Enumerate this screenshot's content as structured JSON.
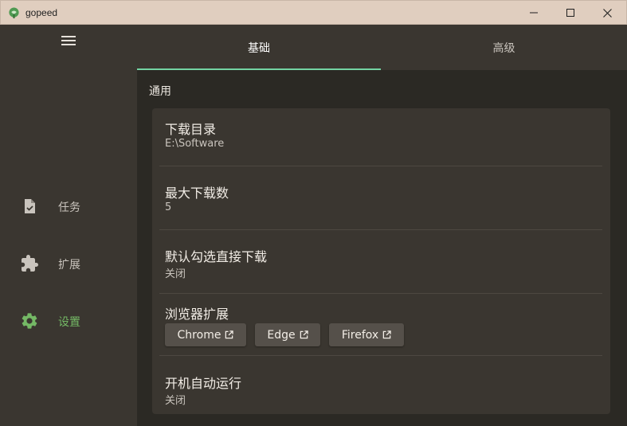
{
  "window": {
    "title": "gopeed",
    "logo_icon": "gopeed-logo-icon",
    "controls": [
      "minimize-icon",
      "maximize-icon",
      "close-icon"
    ]
  },
  "sidebar": {
    "menu_icon": "hamburger-menu-icon",
    "items": [
      {
        "label": "任务",
        "icon": "task-file-icon",
        "active": false
      },
      {
        "label": "扩展",
        "icon": "puzzle-icon",
        "active": false
      },
      {
        "label": "设置",
        "icon": "gear-icon",
        "active": true
      }
    ]
  },
  "tabs": [
    {
      "label": "基础",
      "active": true
    },
    {
      "label": "高级",
      "active": false
    }
  ],
  "section": {
    "title": "通用"
  },
  "settings": {
    "download_dir": {
      "title": "下载目录",
      "value": "E:\\Software"
    },
    "max_downloads": {
      "title": "最大下载数",
      "value": "5"
    },
    "default_direct": {
      "title": "默认勾选直接下载",
      "value": "关闭"
    },
    "browser_ext": {
      "title": "浏览器扩展",
      "buttons": [
        {
          "label": "Chrome",
          "icon": "external-link-icon"
        },
        {
          "label": "Edge",
          "icon": "external-link-icon"
        },
        {
          "label": "Firefox",
          "icon": "external-link-icon"
        }
      ]
    },
    "autostart": {
      "title": "开机自动运行",
      "value": "关闭"
    }
  },
  "colors": {
    "accent": "#74b865",
    "tab_indicator": "#74d4a3",
    "titlebar": "#e0cebf",
    "panel": "#3a3630",
    "background": "#2b2924"
  }
}
